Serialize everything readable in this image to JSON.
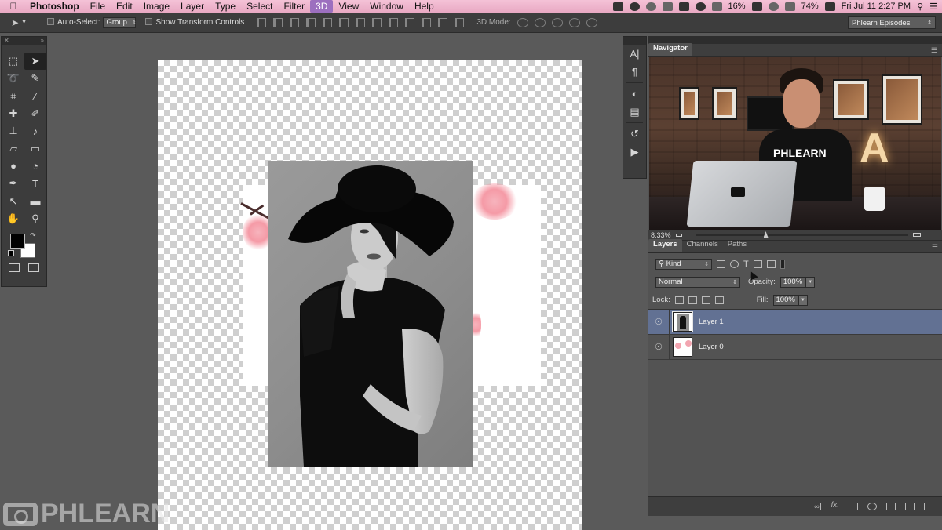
{
  "menubar": {
    "app_name": "Photoshop",
    "items": [
      "File",
      "Edit",
      "Image",
      "Layer",
      "Type",
      "Select",
      "Filter",
      "3D",
      "View",
      "Window",
      "Help"
    ],
    "active_item": "3D",
    "status": {
      "battery_1": "16%",
      "battery_2": "74%",
      "clock": "Fri Jul 11  2:27 PM"
    },
    "icons": [
      "apple-icon",
      "camera-icon",
      "eye-icon",
      "skype-icon",
      "dropbox-icon",
      "evernote-icon",
      "timemachine-icon",
      "bluetooth-icon",
      "battery-icon",
      "airplay-icon",
      "wifi-icon",
      "volume-icon",
      "spotlight-icon",
      "notification-icon"
    ]
  },
  "options_bar": {
    "auto_select_label": "Auto-Select:",
    "auto_select_value": "Group",
    "transform_controls_label": "Show Transform Controls",
    "mode3d_label": "3D Mode:",
    "workspace_value": "Phlearn Episodes"
  },
  "toolbox": {
    "tools": [
      {
        "name": "rectangular-marquee-tool",
        "glyph": "⬚"
      },
      {
        "name": "move-tool",
        "glyph": "➤",
        "selected": true
      },
      {
        "name": "lasso-tool",
        "glyph": "➰"
      },
      {
        "name": "quick-selection-tool",
        "glyph": "✎"
      },
      {
        "name": "crop-tool",
        "glyph": "⌗"
      },
      {
        "name": "eyedropper-tool",
        "glyph": "⁄"
      },
      {
        "name": "spot-healing-tool",
        "glyph": "✚"
      },
      {
        "name": "brush-tool",
        "glyph": "✐"
      },
      {
        "name": "clone-stamp-tool",
        "glyph": "⊥"
      },
      {
        "name": "history-brush-tool",
        "glyph": "♪"
      },
      {
        "name": "eraser-tool",
        "glyph": "▱"
      },
      {
        "name": "gradient-tool",
        "glyph": "▭"
      },
      {
        "name": "blur-tool",
        "glyph": "●"
      },
      {
        "name": "dodge-tool",
        "glyph": "◔"
      },
      {
        "name": "pen-tool",
        "glyph": "✒"
      },
      {
        "name": "type-tool",
        "glyph": "T"
      },
      {
        "name": "path-selection-tool",
        "glyph": "↖"
      },
      {
        "name": "rectangle-tool",
        "glyph": "▬"
      },
      {
        "name": "hand-tool",
        "glyph": "✋"
      },
      {
        "name": "zoom-tool",
        "glyph": "⚲"
      }
    ],
    "foreground_color": "#000000",
    "background_color": "#ffffff"
  },
  "side_icons": [
    "character-icon",
    "paragraph-icon",
    "adjustments-icon",
    "styles-icon",
    "history-icon",
    "actions-icon"
  ],
  "navigator": {
    "tab_label": "Navigator",
    "zoom": "8.33%",
    "preview_shirt_text": "PHLEARN"
  },
  "layers_panel": {
    "tabs": [
      "Layers",
      "Channels",
      "Paths"
    ],
    "filter_value": "Kind",
    "blend_mode": "Normal",
    "opacity_label": "Opacity:",
    "opacity_value": "100%",
    "lock_label": "Lock:",
    "fill_label": "Fill:",
    "fill_value": "100%",
    "layers": [
      {
        "name": "Layer 1",
        "selected": true,
        "visible": true
      },
      {
        "name": "Layer 0",
        "selected": false,
        "visible": true
      }
    ]
  },
  "watermark": {
    "text": "PHLEARN"
  },
  "colors": {
    "menubar_bg": "#f4c2d7",
    "panel_bg": "#535353",
    "selected_layer": "#627193"
  }
}
